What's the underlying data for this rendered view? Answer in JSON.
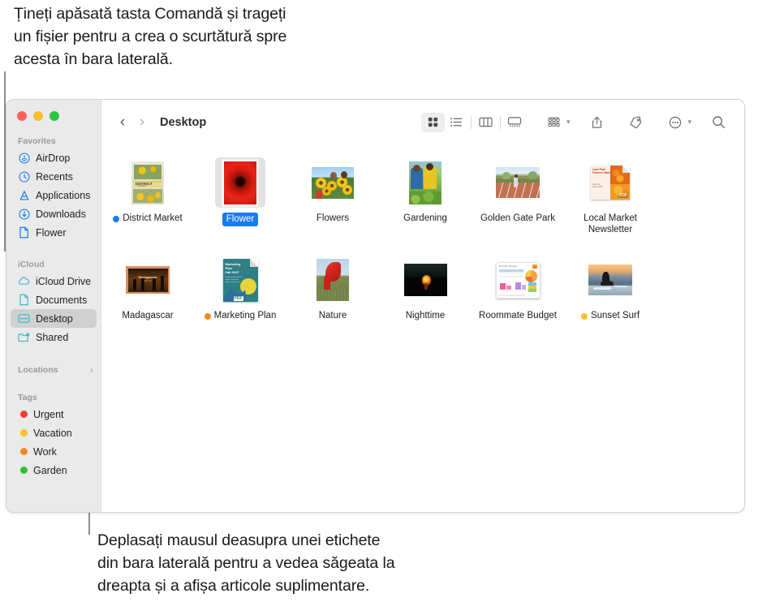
{
  "captions": {
    "top": "Țineți apăsată tasta Comandă și trageți\nun fișier pentru a crea o scurtătură spre\nacesta în bara laterală.",
    "bottom": "Deplasați mausul deasupra unei etichete\ndin bara laterală pentru a vedea săgeata la\ndreapta și a afișa articole suplimentare."
  },
  "window": {
    "traffic_lights": [
      "close-red",
      "minimize-yellow",
      "zoom-green"
    ]
  },
  "toolbar": {
    "back_label": "‹",
    "forward_label": "›",
    "folder_title": "Desktop",
    "buttons": [
      {
        "name": "icon-view-icon",
        "active": true
      },
      {
        "name": "list-view-icon",
        "active": false
      },
      {
        "name": "column-view-icon",
        "active": false
      },
      {
        "name": "gallery-view-icon",
        "active": false
      },
      {
        "name": "group-by-icon",
        "active": false
      },
      {
        "name": "share-icon",
        "active": false
      },
      {
        "name": "tag-icon",
        "active": false
      },
      {
        "name": "more-actions-icon",
        "active": false
      },
      {
        "name": "search-icon",
        "active": false
      }
    ]
  },
  "sidebar": {
    "sections": [
      {
        "title": "Favorites",
        "chevron": "",
        "items": [
          {
            "label": "AirDrop",
            "icon": "airdrop-icon",
            "color": "#1a7bf0",
            "selected": false
          },
          {
            "label": "Recents",
            "icon": "recents-clock-icon",
            "color": "#1a7bf0",
            "selected": false
          },
          {
            "label": "Applications",
            "icon": "applications-icon",
            "color": "#1a7bf0",
            "selected": false
          },
          {
            "label": "Downloads",
            "icon": "downloads-icon",
            "color": "#1a7bf0",
            "selected": false
          },
          {
            "label": "Flower",
            "icon": "document-icon",
            "color": "#1a7bf0",
            "selected": false
          }
        ]
      },
      {
        "title": "iCloud",
        "chevron": "",
        "items": [
          {
            "label": "iCloud Drive",
            "icon": "cloud-icon",
            "color": "#3fb8c8",
            "selected": false
          },
          {
            "label": "Documents",
            "icon": "document-icon",
            "color": "#3fb8c8",
            "selected": false
          },
          {
            "label": "Desktop",
            "icon": "desktop-icon",
            "color": "#3fb8c8",
            "selected": true
          },
          {
            "label": "Shared",
            "icon": "shared-folder-icon",
            "color": "#3fb8c8",
            "selected": false
          }
        ]
      },
      {
        "title": "Locations",
        "chevron": "›",
        "items": []
      },
      {
        "title": "Tags",
        "chevron": "",
        "items": [
          {
            "label": "Urgent",
            "icon": "tag-dot",
            "color": "#ef3b30",
            "selected": false
          },
          {
            "label": "Vacation",
            "icon": "tag-dot",
            "color": "#f9c125",
            "selected": false
          },
          {
            "label": "Work",
            "icon": "tag-dot",
            "color": "#f68a1e",
            "selected": false
          },
          {
            "label": "Garden",
            "icon": "tag-dot",
            "color": "#2bc02b",
            "selected": false
          }
        ]
      }
    ]
  },
  "files": [
    {
      "label": "District Market",
      "tag_color": "#1a7bf0",
      "selected": false,
      "kind": "poster",
      "w": 40,
      "h": 53
    },
    {
      "label": "Flower",
      "tag_color": "",
      "selected": true,
      "kind": "flower",
      "w": 40,
      "h": 53
    },
    {
      "label": "Flowers",
      "tag_color": "",
      "selected": false,
      "kind": "sunflower",
      "w": 52,
      "h": 39
    },
    {
      "label": "Gardening",
      "tag_color": "",
      "selected": false,
      "kind": "garden",
      "w": 40,
      "h": 53
    },
    {
      "label": "Golden Gate Park",
      "tag_color": "",
      "selected": false,
      "kind": "track",
      "w": 54,
      "h": 38
    },
    {
      "label": "Local Market Newsletter",
      "tag_color": "",
      "selected": false,
      "kind": "pdf-market",
      "w": 48,
      "h": 42
    },
    {
      "label": "Madagascar",
      "tag_color": "",
      "selected": false,
      "kind": "madagascar",
      "w": 54,
      "h": 34
    },
    {
      "label": "Marketing Plan",
      "tag_color": "#f68a1e",
      "selected": false,
      "kind": "pdf-plan",
      "w": 43,
      "h": 53
    },
    {
      "label": "Nature",
      "tag_color": "",
      "selected": false,
      "kind": "nature",
      "w": 40,
      "h": 52
    },
    {
      "label": "Nighttime",
      "tag_color": "",
      "selected": false,
      "kind": "night",
      "w": 53,
      "h": 40
    },
    {
      "label": "Roommate Budget",
      "tag_color": "",
      "selected": false,
      "kind": "numbers-doc",
      "w": 55,
      "h": 45
    },
    {
      "label": "Sunset Surf",
      "tag_color": "#f9c125",
      "selected": false,
      "kind": "surf",
      "w": 54,
      "h": 38
    }
  ]
}
